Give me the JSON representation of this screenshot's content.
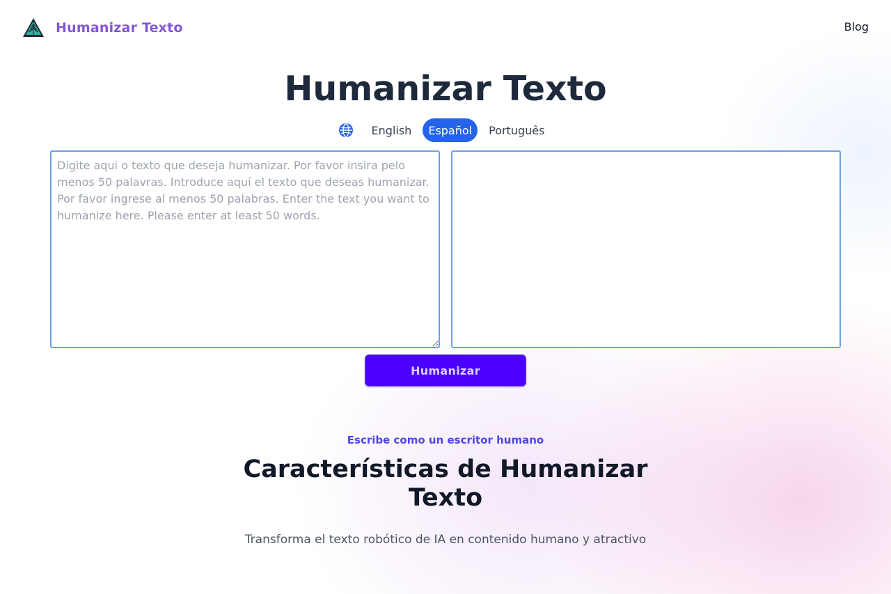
{
  "header": {
    "brand_name": "Humanizar Texto",
    "nav_blog": "Blog",
    "logo_icon": "triangle-logo-icon"
  },
  "hero": {
    "title": "Humanizar Texto"
  },
  "languages": {
    "icon": "globe-icon",
    "options": [
      "English",
      "Español",
      "Português"
    ],
    "selected": "Español"
  },
  "editor": {
    "input_value": "",
    "input_placeholder": "Digite aqui o texto que deseja humanizar. Por favor insira pelo menos 50 palavras. Introduce aquí el texto que deseas humanizar. Por favor ingrese al menos 50 palabras. Enter the text you want to humanize here. Please enter at least 50 words.",
    "output_value": "",
    "button_label": "Humanizar"
  },
  "features": {
    "eyebrow": "Escribe como un escritor humano",
    "title": "Características de Humanizar Texto",
    "subtitle": "Transforma el texto robótico de IA en contenido humano y atractivo"
  },
  "colors": {
    "brand": "#8357d6",
    "primary_button": "#4c00ff",
    "active_language": "#2563eb",
    "editor_border": "#6e9fe6",
    "eyebrow": "#4f46e5"
  }
}
